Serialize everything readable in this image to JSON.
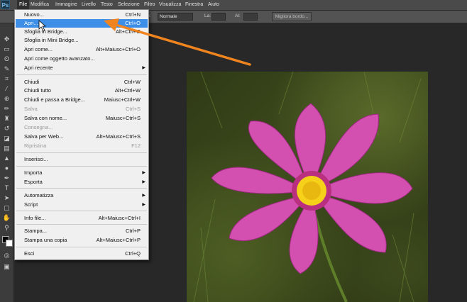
{
  "app": {
    "logo": "Ps"
  },
  "menubar": {
    "items": [
      "File",
      "Modifica",
      "Immagine",
      "Livello",
      "Testo",
      "Selezione",
      "Filtro",
      "Visualizza",
      "Finestra",
      "Aiuto"
    ]
  },
  "options": {
    "label1": "le:",
    "mode_value": "Normale",
    "label2": "La:",
    "label3": "Al:",
    "refine_button": "Migliora bordo..."
  },
  "file_menu": {
    "items": [
      {
        "label": "Nuovo...",
        "shortcut": "Ctrl+N"
      },
      {
        "label": "Apri...",
        "shortcut": "Ctrl+O"
      },
      {
        "label": "Sfoglia in Bridge...",
        "shortcut": "Alt+Ctrl+O"
      },
      {
        "label": "Sfoglia in Mini Bridge...",
        "shortcut": ""
      },
      {
        "label": "Apri come...",
        "shortcut": "Alt+Maiusc+Ctrl+O"
      },
      {
        "label": "Apri come oggetto avanzato...",
        "shortcut": ""
      },
      {
        "label": "Apri recente",
        "shortcut": ""
      },
      {
        "label": "Chiudi",
        "shortcut": "Ctrl+W"
      },
      {
        "label": "Chiudi tutto",
        "shortcut": "Alt+Ctrl+W"
      },
      {
        "label": "Chiudi e passa a Bridge...",
        "shortcut": "Maiusc+Ctrl+W"
      },
      {
        "label": "Salva",
        "shortcut": "Ctrl+S"
      },
      {
        "label": "Salva con nome...",
        "shortcut": "Maiusc+Ctrl+S"
      },
      {
        "label": "Consegna...",
        "shortcut": ""
      },
      {
        "label": "Salva per Web...",
        "shortcut": "Alt+Maiusc+Ctrl+S"
      },
      {
        "label": "Ripristina",
        "shortcut": "F12"
      },
      {
        "label": "Inserisci...",
        "shortcut": ""
      },
      {
        "label": "Importa",
        "shortcut": ""
      },
      {
        "label": "Esporta",
        "shortcut": ""
      },
      {
        "label": "Automatizza",
        "shortcut": ""
      },
      {
        "label": "Script",
        "shortcut": ""
      },
      {
        "label": "Info file...",
        "shortcut": "Alt+Maiusc+Ctrl+I"
      },
      {
        "label": "Stampa...",
        "shortcut": "Ctrl+P"
      },
      {
        "label": "Stampa una copia",
        "shortcut": "Alt+Maiusc+Ctrl+P"
      },
      {
        "label": "Esci",
        "shortcut": "Ctrl+Q"
      }
    ]
  },
  "tools": [
    "move-tool-icon",
    "marquee-tool-icon",
    "lasso-tool-icon",
    "quick-select-icon",
    "crop-tool-icon",
    "eyedropper-icon",
    "healing-brush-icon",
    "brush-tool-icon",
    "clone-stamp-icon",
    "history-brush-icon",
    "eraser-tool-icon",
    "gradient-tool-icon",
    "blur-tool-icon",
    "dodge-tool-icon",
    "pen-tool-icon",
    "type-tool-icon",
    "path-select-icon",
    "shape-tool-icon",
    "hand-tool-icon",
    "zoom-tool-icon"
  ],
  "colors": {
    "menu_highlight": "#3c8ee6",
    "arrow": "#f0841f",
    "petal": "#d34fb0",
    "center": "#f5d11a"
  }
}
